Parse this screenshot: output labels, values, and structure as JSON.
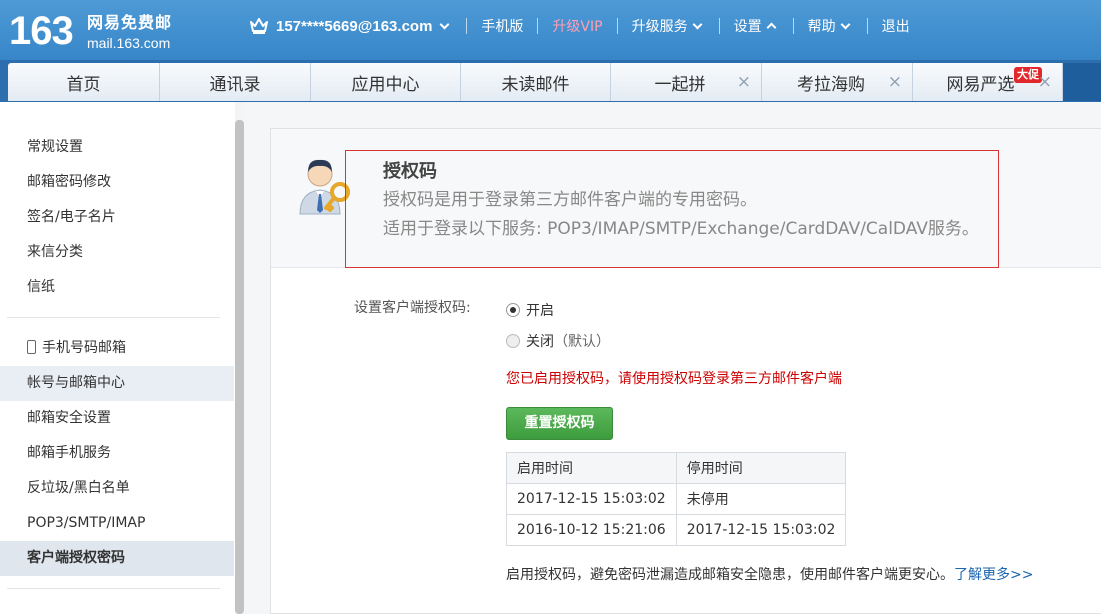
{
  "header": {
    "logo_number": "163",
    "logo_cn": "网易免费邮",
    "logo_en": "mail.163.com",
    "account": "157****5669@163.com",
    "links": {
      "mobile": "手机版",
      "vip": "升级VIP",
      "upgrade_service": "升级服务",
      "settings": "设置",
      "help": "帮助",
      "logout": "退出"
    }
  },
  "tabs": [
    {
      "label": "首页"
    },
    {
      "label": "通讯录"
    },
    {
      "label": "应用中心"
    },
    {
      "label": "未读邮件"
    },
    {
      "label": "一起拼",
      "close": "×"
    },
    {
      "label": "考拉海购",
      "close": "×"
    },
    {
      "label": "网易严选",
      "close": "×",
      "badge": "大促"
    }
  ],
  "sidebar": {
    "items": [
      {
        "label": "常规设置"
      },
      {
        "label": "邮箱密码修改"
      },
      {
        "label": "签名/电子名片"
      },
      {
        "label": "来信分类"
      },
      {
        "label": "信纸"
      },
      {
        "label": "手机号码邮箱"
      },
      {
        "label": "帐号与邮箱中心"
      },
      {
        "label": "邮箱安全设置"
      },
      {
        "label": "邮箱手机服务"
      },
      {
        "label": "反垃圾/黑白名单"
      },
      {
        "label": "POP3/SMTP/IMAP"
      },
      {
        "label": "客户端授权密码"
      }
    ]
  },
  "main": {
    "title": "授权码",
    "desc1": "授权码是用于登录第三方邮件客户端的专用密码。",
    "desc2": "适用于登录以下服务: POP3/IMAP/SMTP/Exchange/CardDAV/CalDAV服务。",
    "setting_label": "设置客户端授权码:",
    "option_on": "开启",
    "option_off": "关闭",
    "option_off_note": "（默认）",
    "selected": "开启",
    "notice": "您已启用授权码，请使用授权码登录第三方邮件客户端",
    "reset_button": "重置授权码",
    "table": {
      "headers": [
        "启用时间",
        "停用时间"
      ],
      "rows": [
        [
          "2017-12-15 15:03:02",
          "未停用"
        ],
        [
          "2016-10-12 15:21:06",
          "2017-12-15 15:03:02"
        ]
      ]
    },
    "footer_note": "启用授权码，避免密码泄漏造成邮箱安全隐患，使用邮件客户端更安心。",
    "learn_more": "了解更多>>"
  },
  "colors": {
    "header_blue": "#3f8dd0",
    "tab_bar_blue": "#2d6fae",
    "vip_pink": "#ff9fb4",
    "notice_red": "#cc0000",
    "button_green": "#4cae4c",
    "link_blue": "#1a64b0",
    "highlight_border": "#d93333"
  }
}
